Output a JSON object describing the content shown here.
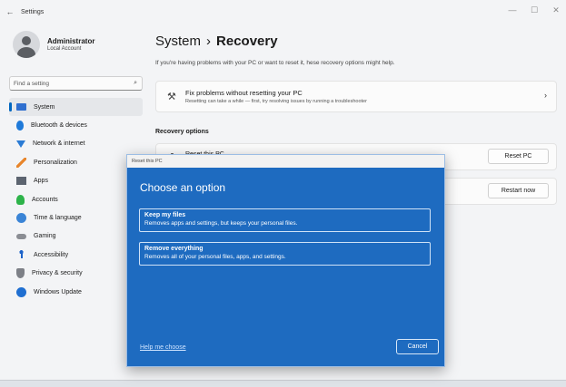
{
  "window": {
    "title": "Settings",
    "back": "←",
    "controls": {
      "minimize": "—",
      "maximize": "☐",
      "close": "✕"
    }
  },
  "profile": {
    "name": "Administrator",
    "subtitle": "Local Account"
  },
  "search": {
    "placeholder": "Find a setting",
    "icon": "search-icon"
  },
  "sidebar": {
    "items": [
      {
        "label": "System",
        "icon": "system-icon",
        "active": true
      },
      {
        "label": "Bluetooth & devices",
        "icon": "bluetooth-icon"
      },
      {
        "label": "Network & internet",
        "icon": "network-icon"
      },
      {
        "label": "Personalization",
        "icon": "brush-icon"
      },
      {
        "label": "Apps",
        "icon": "apps-icon"
      },
      {
        "label": "Accounts",
        "icon": "accounts-icon"
      },
      {
        "label": "Time & language",
        "icon": "globe-icon"
      },
      {
        "label": "Gaming",
        "icon": "gamepad-icon"
      },
      {
        "label": "Accessibility",
        "icon": "accessibility-icon"
      },
      {
        "label": "Privacy & security",
        "icon": "shield-icon"
      },
      {
        "label": "Windows Update",
        "icon": "update-icon"
      }
    ]
  },
  "header": {
    "parent": "System",
    "separator": "›",
    "current": "Recovery",
    "subtitle": "If you're having problems with your PC or want to reset it, hese recovery options might help."
  },
  "fix_card": {
    "title": "Fix problems without resetting your PC",
    "description": "Resetting can take a while — first, try resolving issues by running a troubleshooter",
    "chevron": "›"
  },
  "recovery": {
    "section_title": "Recovery options",
    "reset_title": "Reset this PC",
    "reset_button": "Reset PC",
    "restart_button": "Restart now"
  },
  "dialog": {
    "title": "Reset this PC",
    "heading": "Choose an option",
    "options": [
      {
        "title": "Keep my files",
        "description": "Removes apps and settings, but keeps your personal files."
      },
      {
        "title": "Remove everything",
        "description": "Removes all of your personal files, apps, and settings."
      }
    ],
    "help_link": "Help me choose",
    "cancel": "Cancel"
  },
  "colors": {
    "accent": "#0067c0",
    "dialog_bg": "#1e6bc0"
  }
}
